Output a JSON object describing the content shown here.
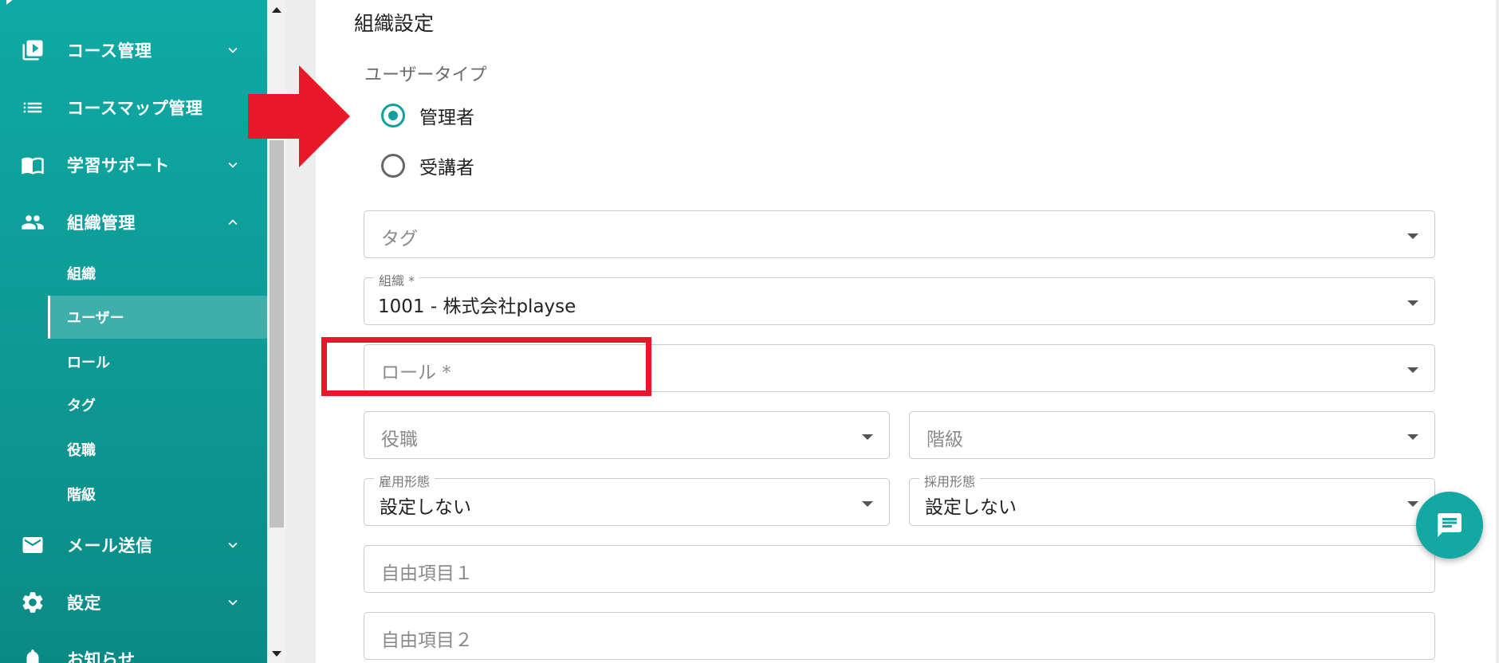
{
  "sidebar": {
    "items": [
      {
        "label": "コース管理",
        "icon": "video-library-icon",
        "expanded": false
      },
      {
        "label": "コースマップ管理",
        "icon": "list-icon"
      },
      {
        "label": "学習サポート",
        "icon": "book-icon",
        "expanded": false
      },
      {
        "label": "組織管理",
        "icon": "people-icon",
        "expanded": true
      },
      {
        "label": "メール送信",
        "icon": "mail-icon",
        "expanded": false
      },
      {
        "label": "設定",
        "icon": "gear-icon",
        "expanded": false
      },
      {
        "label": "お知らせ",
        "icon": "bell-icon"
      }
    ],
    "sub_items": [
      {
        "label": "組織"
      },
      {
        "label": "ユーザー",
        "active": true
      },
      {
        "label": "ロール"
      },
      {
        "label": "タグ"
      },
      {
        "label": "役職"
      },
      {
        "label": "階級"
      }
    ]
  },
  "form": {
    "section_title": "組織設定",
    "user_type": {
      "label": "ユーザータイプ",
      "options": [
        {
          "label": "管理者",
          "checked": true
        },
        {
          "label": "受講者",
          "checked": false
        }
      ]
    },
    "tag": {
      "placeholder": "タグ"
    },
    "organization": {
      "label": "組織 *",
      "value": "1001 - 株式会社playse"
    },
    "role": {
      "placeholder": "ロール *"
    },
    "position": {
      "placeholder": "役職"
    },
    "rank": {
      "placeholder": "階級"
    },
    "employment_type": {
      "label": "雇用形態",
      "value": "設定しない"
    },
    "hiring_type": {
      "label": "採用形態",
      "value": "設定しない"
    },
    "free_item_1": {
      "placeholder": "自由項目１"
    },
    "free_item_2": {
      "placeholder": "自由項目２"
    }
  },
  "colors": {
    "accent": "#10a19b",
    "annotation": "#e8182a"
  }
}
